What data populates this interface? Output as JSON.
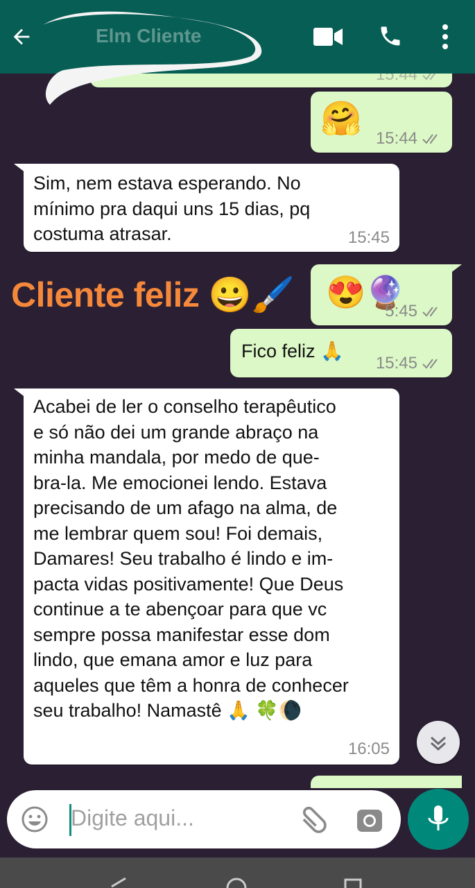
{
  "header": {
    "contact_name": "Elm Cliente",
    "icons": [
      "back-arrow-icon",
      "video-call-icon",
      "phone-icon",
      "more-vert-icon"
    ],
    "color": "#075e54"
  },
  "messages": [
    {
      "direction": "out",
      "text": "",
      "time": "15:44",
      "status": "read"
    },
    {
      "direction": "out",
      "text": "🤗",
      "time": "15:44",
      "status": "read"
    },
    {
      "direction": "in",
      "text": "Sim, nem estava esperando. No\nmínimo pra daqui uns 15 dias, pq\ncostuma atrasar.",
      "time": "15:45"
    },
    {
      "direction": "out",
      "text": "😍🔮",
      "time": "5:45",
      "status": "read"
    },
    {
      "direction": "out",
      "text": "Fico feliz 🙏",
      "time": "15:45",
      "status": "read"
    },
    {
      "direction": "in",
      "text": "Acabei de ler o conselho terapêutico\ne só não dei um grande abraço na\nminha mandala, por medo de que-\nbra-la. Me emocionei lendo. Estava\nprecisando de um afago na alma, de\nme lembrar quem sou! Foi demais,\nDamares! Seu trabalho é lindo e im-\npacta vidas positivamente! Que Deus\ncontinue a te abençoar para que vc\nsempre possa manifestar esse dom\nlindo, que emana amor e luz para\naqueles que têm a honra de conhecer\nseu trabalho! Namastê 🙏 🍀🌘",
      "time": "16:05"
    }
  ],
  "overlay": {
    "text": "Cliente feliz 😀🖌️"
  },
  "composer": {
    "placeholder": "Digite aqui..."
  },
  "colors": {
    "outgoing": "#dcf8c6",
    "incoming": "#ffffff",
    "background": "#2a1f33",
    "accent": "#00897b",
    "ticks": "#8a8a8a"
  }
}
